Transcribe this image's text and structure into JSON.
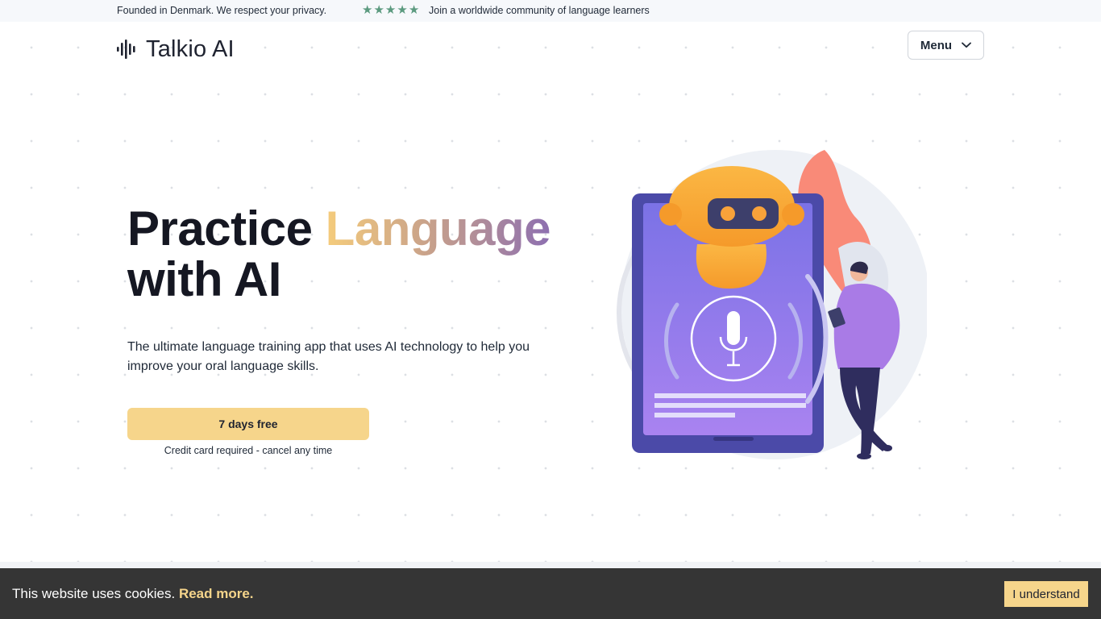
{
  "topbar": {
    "privacy_text": "Founded in Denmark. We respect your privacy.",
    "rating_stars": 5,
    "star_color": "#5b9a7f",
    "community_text": "Join a worldwide community of language learners"
  },
  "header": {
    "logo_text": "Talkio AI",
    "logo_icon": "soundwave-icon",
    "menu_label": "Menu",
    "menu_icon": "chevron-down-icon"
  },
  "hero": {
    "title_part1": "Practice ",
    "title_highlight": "Language",
    "title_part2": "with AI",
    "subtitle": "The ultimate language training app that uses AI technology to help you improve your oral language skills.",
    "cta_label": "7 days free",
    "cta_note": "Credit card required - cancel any time",
    "illustration": "robot-tablet-microphone-illustration"
  },
  "cookie_banner": {
    "message": "This website uses cookies.",
    "link_label": "Read more.",
    "accept_label": "I understand"
  },
  "colors": {
    "accent": "#f6d58b",
    "text_dark": "#151722",
    "cookie_bg": "#353535",
    "gradient_start": "#f5cc7c",
    "gradient_end": "#8d6fb0"
  }
}
